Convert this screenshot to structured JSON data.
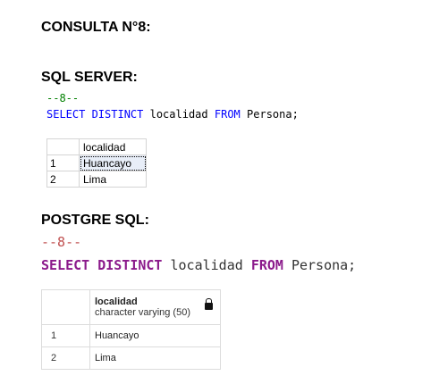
{
  "title": "CONSULTA N°8:",
  "sql_server": {
    "heading": "SQL SERVER:",
    "comment": "--8--",
    "query": {
      "kw1": "SELECT DISTINCT",
      "col": "localidad",
      "kw2": "FROM",
      "table": "Persona;"
    },
    "grid": {
      "header": "localidad",
      "rows": [
        {
          "num": "1",
          "value": "Huancayo"
        },
        {
          "num": "2",
          "value": "Lima"
        }
      ]
    }
  },
  "postgres": {
    "heading": "POSTGRE SQL:",
    "comment": "--8--",
    "query": {
      "kw1": "SELECT DISTINCT",
      "col": "localidad",
      "kw2": "FROM",
      "table": "Persona;"
    },
    "grid": {
      "header_name": "localidad",
      "header_type": "character varying (50)",
      "rows": [
        {
          "num": "1",
          "value": "Huancayo"
        },
        {
          "num": "2",
          "value": "Lima"
        }
      ]
    }
  },
  "icons": {
    "column_lock": "lock-icon"
  }
}
